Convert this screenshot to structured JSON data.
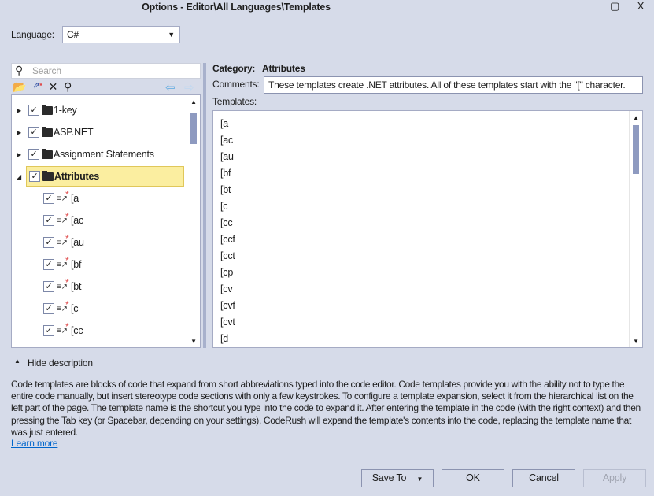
{
  "window": {
    "title": "Options - Editor\\All Languages\\Templates",
    "maximize_icon": "maximize-icon",
    "close_label": "X"
  },
  "language": {
    "label": "Language:",
    "value": "C#"
  },
  "search": {
    "placeholder": "Search"
  },
  "toolbar": {
    "icons": [
      "new-folder-icon",
      "new-template-icon",
      "delete-icon",
      "find-icon",
      "back-arrow-icon",
      "forward-arrow-icon"
    ]
  },
  "tree": {
    "categories": [
      {
        "label": "1-key",
        "expanded": false,
        "checked": true
      },
      {
        "label": "ASP.NET",
        "expanded": false,
        "checked": true
      },
      {
        "label": "Assignment Statements",
        "expanded": false,
        "checked": true
      },
      {
        "label": "Attributes",
        "expanded": true,
        "checked": true,
        "selected": true
      }
    ],
    "children": [
      "[a",
      "[ac",
      "[au",
      "[bf",
      "[bt",
      "[c",
      "[cc"
    ]
  },
  "details": {
    "category_label": "Category:",
    "category_value": "Attributes",
    "comments_label": "Comments:",
    "comments_value": "These templates create .NET attributes. All of these templates start with the \"[\" character.",
    "templates_label": "Templates:",
    "templates": [
      "[a",
      "[ac",
      "[au",
      "[bf",
      "[bt",
      "[c",
      "[cc",
      "[ccf",
      "[cct",
      "[cp",
      "[cv",
      "[cvf",
      "[cvt",
      "[d"
    ]
  },
  "description": {
    "toggle_label": "Hide description",
    "text": "Code templates are blocks of code that expand from short abbreviations typed into the code editor. Code templates provide you with the ability not to type the entire code manually, but insert stereotype code sections with only a few keystrokes. To configure a template expansion, select it from the hierarchical list on the left part of the page. The template name is the shortcut you type into the code to expand it. After entering the template in the code (with the right context) and then pressing the Tab key (or Spacebar, depending on your settings), CodeRush will expand the template's contents into the code, replacing the template name that was just entered.",
    "link": "Learn more"
  },
  "buttons": {
    "save_to": "Save To",
    "ok": "OK",
    "cancel": "Cancel",
    "apply": "Apply",
    "apply_enabled": false
  }
}
